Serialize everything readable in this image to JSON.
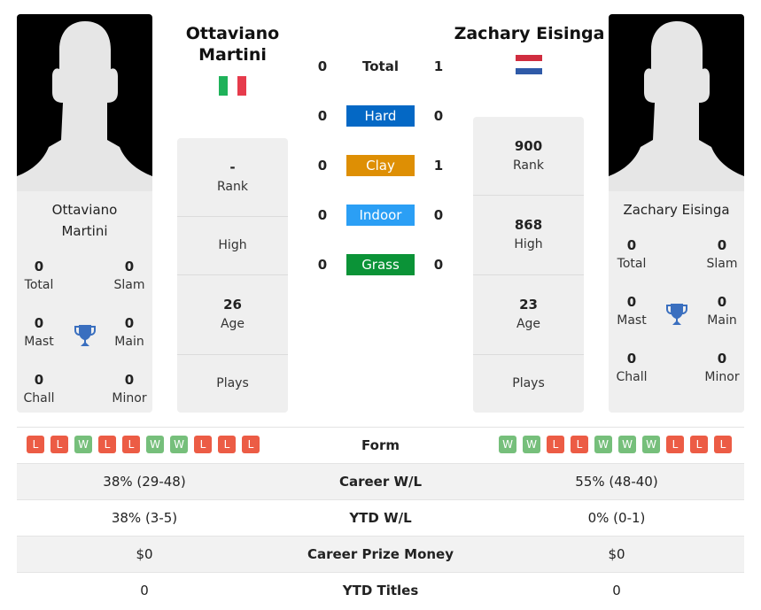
{
  "colors": {
    "hard": "#0468c5",
    "clay": "#de8f04",
    "indoor": "#2b9ff5",
    "grass": "#0b9337",
    "win": "#76bf7b",
    "loss": "#ec5c45",
    "trophy": "#3a6fbf"
  },
  "player1": {
    "name": "Ottaviano Martini",
    "name_line1": "Ottaviano",
    "name_line2": "Martini",
    "country_flag": "italy-flag",
    "titles": {
      "total": "0",
      "total_label": "Total",
      "slam": "0",
      "slam_label": "Slam",
      "mast": "0",
      "mast_label": "Mast",
      "main": "0",
      "main_label": "Main",
      "chall": "0",
      "chall_label": "Chall",
      "minor": "0",
      "minor_label": "Minor"
    },
    "info": {
      "rank": "-",
      "rank_label": "Rank",
      "high": "",
      "high_label": "High",
      "age": "26",
      "age_label": "Age",
      "plays": "",
      "plays_label": "Plays"
    },
    "form": [
      "L",
      "L",
      "W",
      "L",
      "L",
      "W",
      "W",
      "L",
      "L",
      "L"
    ],
    "career_wl": "38% (29-48)",
    "ytd_wl": "38% (3-5)",
    "prize_money": "$0",
    "ytd_titles": "0"
  },
  "player2": {
    "name": "Zachary Eisinga",
    "country_flag": "netherlands-flag",
    "titles": {
      "total": "0",
      "total_label": "Total",
      "slam": "0",
      "slam_label": "Slam",
      "mast": "0",
      "mast_label": "Mast",
      "main": "0",
      "main_label": "Main",
      "chall": "0",
      "chall_label": "Chall",
      "minor": "0",
      "minor_label": "Minor"
    },
    "info": {
      "rank": "900",
      "rank_label": "Rank",
      "high": "868",
      "high_label": "High",
      "age": "23",
      "age_label": "Age",
      "plays": "",
      "plays_label": "Plays"
    },
    "form": [
      "W",
      "W",
      "L",
      "L",
      "W",
      "W",
      "W",
      "L",
      "L",
      "L"
    ],
    "career_wl": "55% (48-40)",
    "ytd_wl": "0% (0-1)",
    "prize_money": "$0",
    "ytd_titles": "0"
  },
  "h2h": [
    {
      "label": "Total",
      "p1": "0",
      "p2": "1"
    },
    {
      "label": "Hard",
      "p1": "0",
      "p2": "0"
    },
    {
      "label": "Clay",
      "p1": "0",
      "p2": "1"
    },
    {
      "label": "Indoor",
      "p1": "0",
      "p2": "0"
    },
    {
      "label": "Grass",
      "p1": "0",
      "p2": "0"
    }
  ],
  "stats_labels": {
    "form": "Form",
    "career_wl": "Career W/L",
    "ytd_wl": "YTD W/L",
    "prize_money": "Career Prize Money",
    "ytd_titles": "YTD Titles"
  }
}
